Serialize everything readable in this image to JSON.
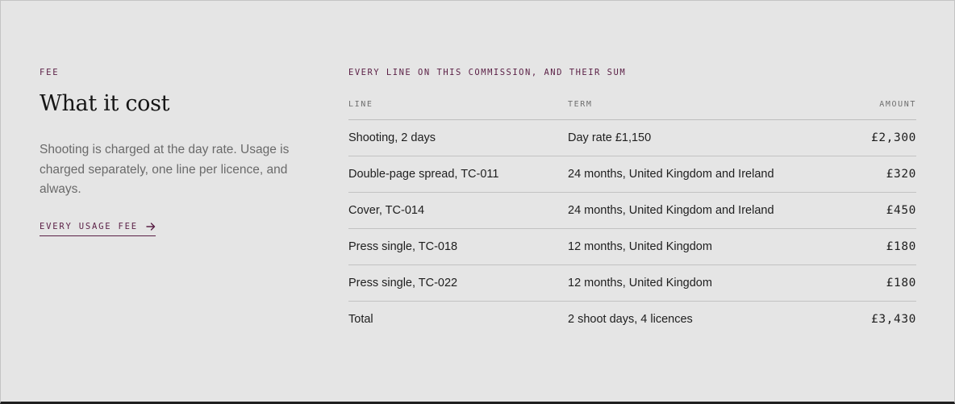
{
  "fee_intro": {
    "eyebrow": "FEE",
    "title": "What it cost",
    "description": "Shooting is charged at the day rate. Usage is charged separately, one line per licence, and always.",
    "link_label": "EVERY USAGE FEE",
    "link_icon": "arrow-right-icon"
  },
  "fee_table": {
    "caption": "EVERY LINE ON THIS COMMISSION, AND THEIR SUM",
    "headers": {
      "line": "LINE",
      "term": "TERM",
      "amount": "AMOUNT"
    },
    "rows": [
      {
        "line": "Shooting, 2 days",
        "term": "Day rate £1,150",
        "amount": "£2,300"
      },
      {
        "line": "Double-page spread, TC-011",
        "term": "24 months, United Kingdom and Ireland",
        "amount": "£320"
      },
      {
        "line": "Cover, TC-014",
        "term": "24 months, United Kingdom and Ireland",
        "amount": "£450"
      },
      {
        "line": "Press single, TC-018",
        "term": "12 months, United Kingdom",
        "amount": "£180"
      },
      {
        "line": "Press single, TC-022",
        "term": "12 months, United Kingdom",
        "amount": "£180"
      }
    ],
    "total": {
      "line": "Total",
      "term": "2 shoot days, 4 licences",
      "amount": "£3,430"
    }
  },
  "colors": {
    "background": "#e5e5e5",
    "accent": "#5a1f45",
    "text": "#1c1c1c",
    "muted_text": "#6a6a6a",
    "rule": "#c2c2c2"
  }
}
